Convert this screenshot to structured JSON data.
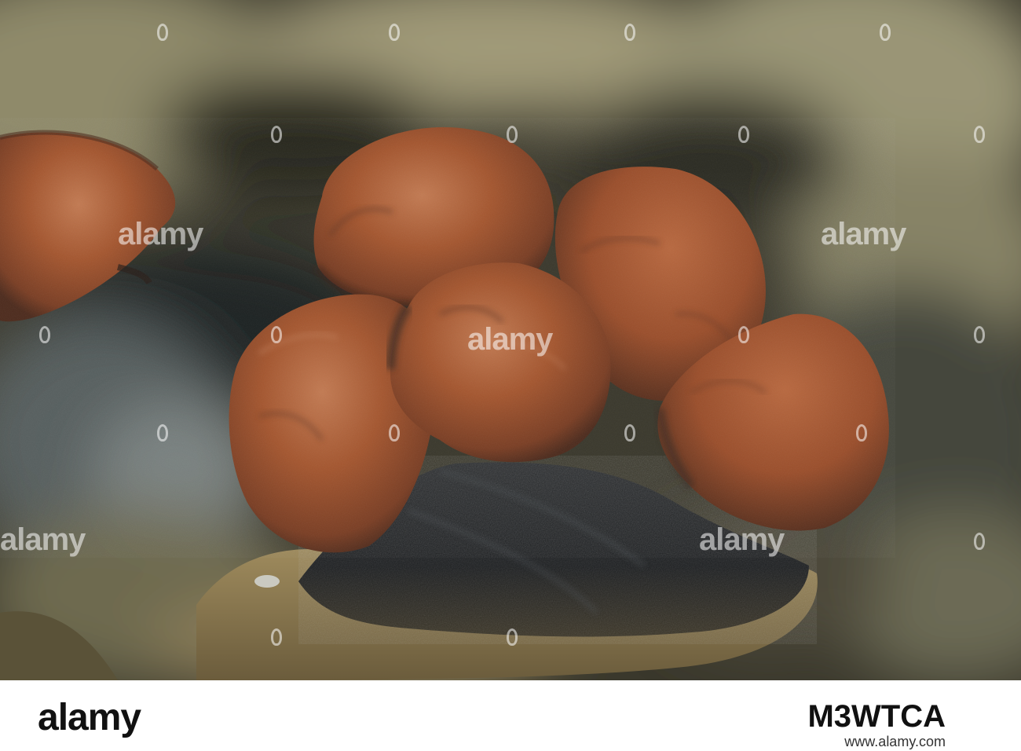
{
  "photo": {
    "subject": "fungus-fruiting-bodies-on-wood",
    "colors": {
      "background_dark": "#2c2b22",
      "background_light": "#8e8a6e",
      "cap_main": "#a4562f",
      "cap_shadow": "#5c3322",
      "cap_highlight": "#c98a66",
      "wood_dark": "#1f2225",
      "wood_light": "#8c7b55"
    }
  },
  "watermark": {
    "text": "alamy"
  },
  "footer": {
    "logo": "alamy",
    "image_id": "M3WTCA",
    "url": "www.alamy.com"
  }
}
